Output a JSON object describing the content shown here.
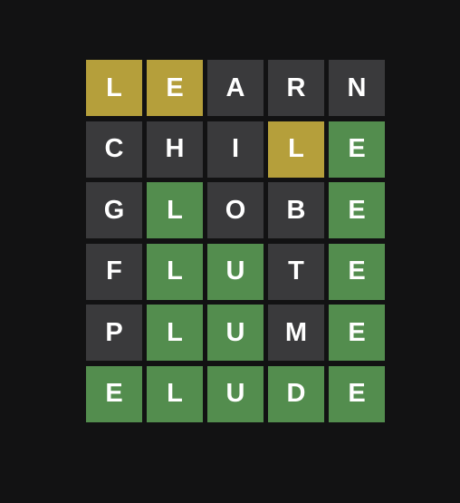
{
  "colors": {
    "background": "#121213",
    "correct": "#538d4e",
    "present": "#b59f3b",
    "absent": "#3a3a3c",
    "text": "#ffffff"
  },
  "board": {
    "rows": [
      {
        "tiles": [
          {
            "letter": "L",
            "state": "present"
          },
          {
            "letter": "E",
            "state": "present"
          },
          {
            "letter": "A",
            "state": "absent"
          },
          {
            "letter": "R",
            "state": "absent"
          },
          {
            "letter": "N",
            "state": "absent"
          }
        ]
      },
      {
        "tiles": [
          {
            "letter": "C",
            "state": "absent"
          },
          {
            "letter": "H",
            "state": "absent"
          },
          {
            "letter": "I",
            "state": "absent"
          },
          {
            "letter": "L",
            "state": "present"
          },
          {
            "letter": "E",
            "state": "correct"
          }
        ]
      },
      {
        "tiles": [
          {
            "letter": "G",
            "state": "absent"
          },
          {
            "letter": "L",
            "state": "correct"
          },
          {
            "letter": "O",
            "state": "absent"
          },
          {
            "letter": "B",
            "state": "absent"
          },
          {
            "letter": "E",
            "state": "correct"
          }
        ]
      },
      {
        "tiles": [
          {
            "letter": "F",
            "state": "absent"
          },
          {
            "letter": "L",
            "state": "correct"
          },
          {
            "letter": "U",
            "state": "correct"
          },
          {
            "letter": "T",
            "state": "absent"
          },
          {
            "letter": "E",
            "state": "correct"
          }
        ]
      },
      {
        "tiles": [
          {
            "letter": "P",
            "state": "absent"
          },
          {
            "letter": "L",
            "state": "correct"
          },
          {
            "letter": "U",
            "state": "correct"
          },
          {
            "letter": "M",
            "state": "absent"
          },
          {
            "letter": "E",
            "state": "correct"
          }
        ]
      },
      {
        "tiles": [
          {
            "letter": "E",
            "state": "correct"
          },
          {
            "letter": "L",
            "state": "correct"
          },
          {
            "letter": "U",
            "state": "correct"
          },
          {
            "letter": "D",
            "state": "correct"
          },
          {
            "letter": "E",
            "state": "correct"
          }
        ]
      }
    ]
  }
}
